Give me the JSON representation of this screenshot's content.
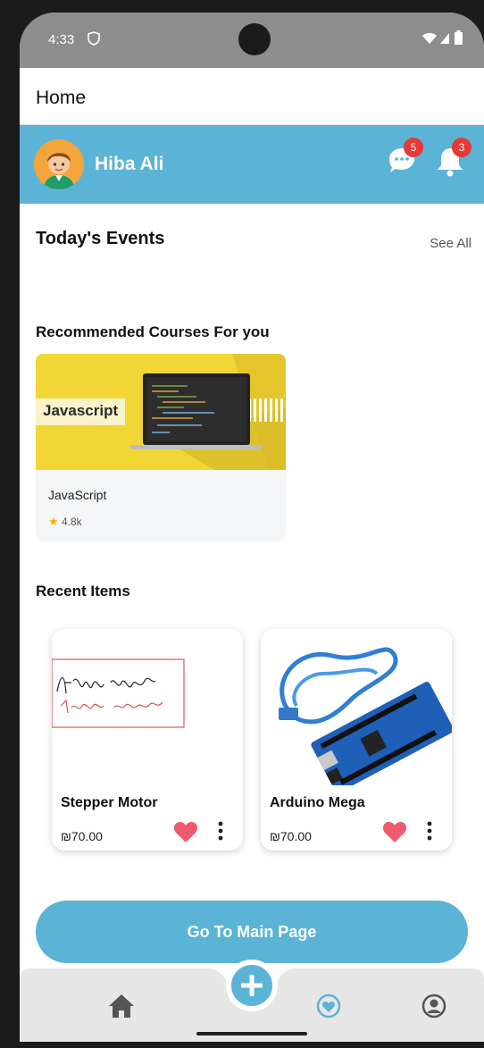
{
  "status_bar": {
    "time": "4:33",
    "icons": [
      "shield-icon",
      "wifi-icon",
      "signal-icon",
      "battery-icon"
    ]
  },
  "app_bar": {
    "title": "Home"
  },
  "profile": {
    "name": "Hiba Ali",
    "messages_badge": "5",
    "notifications_badge": "3"
  },
  "events": {
    "title": "Today's Events",
    "see_all": "See All"
  },
  "courses": {
    "title": "Recommended Courses For you",
    "items": [
      {
        "image_label": "Javascript",
        "name": "JavaScript",
        "rating": "4.8k"
      }
    ]
  },
  "recent": {
    "title": "Recent Items",
    "items": [
      {
        "name": "Stepper Motor",
        "price": "₪70.00"
      },
      {
        "name": "Arduino Mega",
        "price": "₪70.00"
      }
    ]
  },
  "main_button": {
    "label": "Go To Main Page"
  },
  "colors": {
    "accent": "#5bb4d6",
    "badge": "#e53935",
    "heart": "#ef5b6e",
    "course_bg": "#f2d636"
  }
}
